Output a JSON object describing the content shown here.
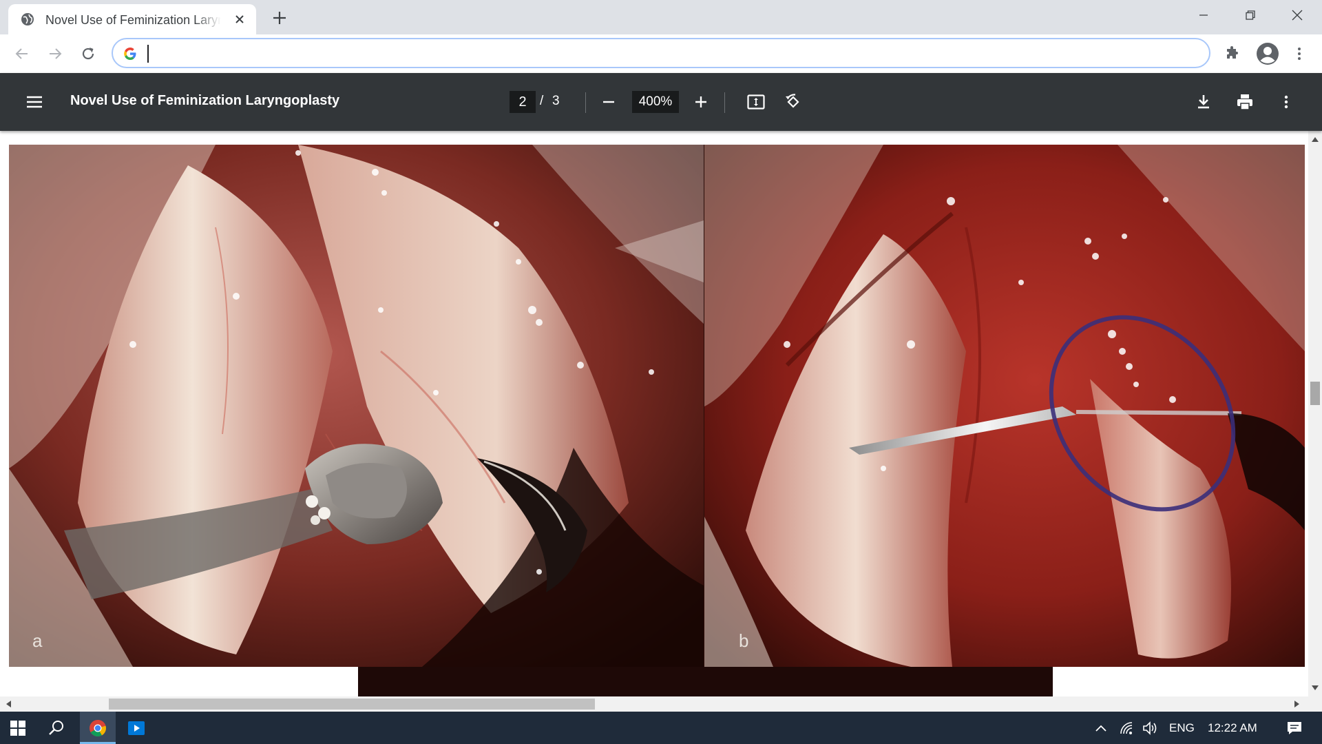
{
  "browser": {
    "tab": {
      "title": "Novel Use of Feminization Laryngoplasty"
    },
    "address_bar": {
      "value": "",
      "placeholder": ""
    }
  },
  "pdf_viewer": {
    "title": "Novel Use of Feminization Laryngoplasty",
    "current_page": "2",
    "page_separator": "/",
    "total_pages": "3",
    "zoom": "400%"
  },
  "figure": {
    "panel_a_label": "a",
    "panel_b_label": "b"
  },
  "taskbar": {
    "language": "ENG",
    "time": "12:22 AM"
  },
  "colors": {
    "chrome_tabstrip": "#dee1e6",
    "pdf_toolbar": "#323639",
    "taskbar": "#1f2b3a",
    "omnibox_focus": "#a8c7fa"
  },
  "icons": [
    "globe-icon",
    "close-icon",
    "plus-icon",
    "minimize-icon",
    "restore-icon",
    "back-icon",
    "forward-icon",
    "reload-icon",
    "google-icon",
    "extensions-icon",
    "profile-icon",
    "kebab-menu-icon",
    "hamburger-menu-icon",
    "zoom-out-icon",
    "zoom-in-icon",
    "fit-page-icon",
    "rotate-icon",
    "download-icon",
    "print-icon",
    "windows-start-icon",
    "search-icon",
    "chrome-icon",
    "media-player-icon",
    "chevron-up-icon",
    "wifi-icon",
    "volume-icon",
    "notification-icon"
  ]
}
